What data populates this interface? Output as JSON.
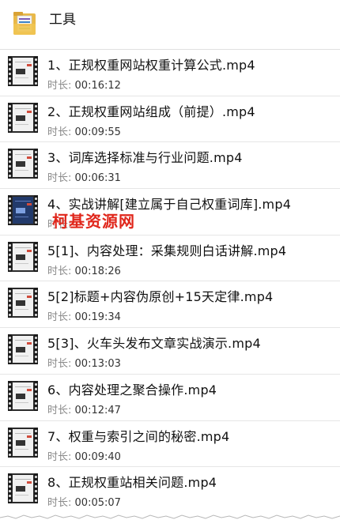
{
  "folder": {
    "name": "工具",
    "icon": "folder-archive-icon"
  },
  "items": [
    {
      "title": "1、正规权重网站权重计算公式.mp4",
      "duration_label": "时长:",
      "duration": "00:16:12",
      "thumb": "video-thumbnail-icon"
    },
    {
      "title": "2、正规权重网站组成（前提）.mp4",
      "duration_label": "时长:",
      "duration": "00:09:55",
      "thumb": "video-thumbnail-icon"
    },
    {
      "title": "3、词库选择标准与行业问题.mp4",
      "duration_label": "时长:",
      "duration": "00:06:31",
      "thumb": "video-thumbnail-icon"
    },
    {
      "title": "4、实战讲解[建立属于自己权重词库].mp4",
      "duration_label": "时长:",
      "duration": "",
      "thumb": "video-thumbnail-icon"
    },
    {
      "title": "5[1]、内容处理：采集规则白话讲解.mp4",
      "duration_label": "时长:",
      "duration": "00:18:26",
      "thumb": "video-thumbnail-icon"
    },
    {
      "title": "5[2]标题+内容伪原创+15天定律.mp4",
      "duration_label": "时长:",
      "duration": "00:19:34",
      "thumb": "video-thumbnail-icon"
    },
    {
      "title": "5[3]、火车头发布文章实战演示.mp4",
      "duration_label": "时长:",
      "duration": "00:13:03",
      "thumb": "video-thumbnail-icon"
    },
    {
      "title": "6、内容处理之聚合操作.mp4",
      "duration_label": "时长:",
      "duration": "00:12:47",
      "thumb": "video-thumbnail-icon"
    },
    {
      "title": "7、权重与索引之间的秘密.mp4",
      "duration_label": "时长:",
      "duration": "00:09:40",
      "thumb": "video-thumbnail-icon"
    },
    {
      "title": "8、正规权重站相关问题.mp4",
      "duration_label": "时长:",
      "duration": "00:05:07",
      "thumb": "video-thumbnail-icon"
    }
  ],
  "watermark": {
    "text": "柯基资源网",
    "color": "#e0261b"
  }
}
